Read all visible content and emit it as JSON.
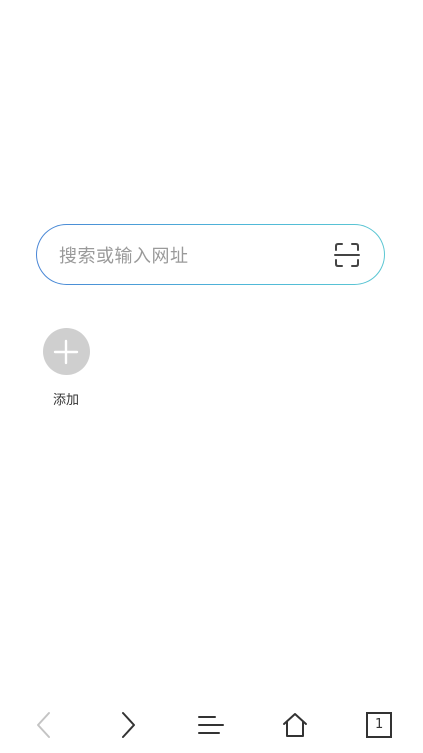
{
  "search": {
    "placeholder": "搜索或输入网址",
    "scan_icon": "scan-icon",
    "border_gradient": [
      "#4a86d6",
      "#5cc7d3"
    ]
  },
  "shortcuts": [
    {
      "label": "添加",
      "icon": "plus-icon",
      "bg_color": "#cfcfcf"
    }
  ],
  "bottom_bar": {
    "back_icon": "chevron-left-icon",
    "forward_icon": "chevron-right-icon",
    "menu_icon": "menu-icon",
    "home_icon": "home-icon",
    "tabs_icon": "tabs-icon",
    "tab_count": "1",
    "back_enabled": false
  }
}
